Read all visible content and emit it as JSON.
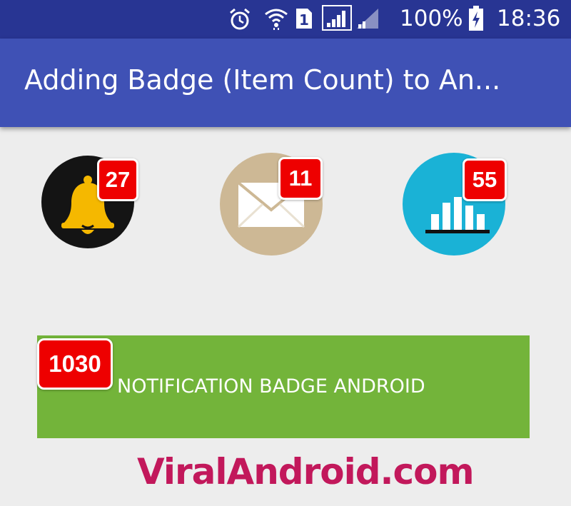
{
  "status_bar": {
    "battery": "100%",
    "time": "18:36",
    "sim": "1",
    "icons": [
      "alarm-icon",
      "wifi-icon",
      "sim-icon",
      "signal-icon",
      "signal-icon",
      "battery-charging-icon"
    ]
  },
  "app_bar": {
    "title": "Adding Badge (Item Count) to An..."
  },
  "icons": [
    {
      "name": "bell",
      "badge": "27",
      "bg": "#141414",
      "fg": "#f5b800"
    },
    {
      "name": "mail",
      "badge": "11",
      "bg": "#cdb895",
      "fg": "#ffffff"
    },
    {
      "name": "chart",
      "badge": "55",
      "bg": "#1ab2d6",
      "fg": "#ffffff"
    }
  ],
  "banner": {
    "badge": "1030",
    "label": "NOTIFICATION BADGE ANDROID",
    "bg": "#73b43a"
  },
  "watermark": "ViralAndroid.com",
  "colors": {
    "status_bar": "#283593",
    "app_bar": "#3f51b5",
    "badge": "#ee0000",
    "watermark": "#c2185b"
  }
}
